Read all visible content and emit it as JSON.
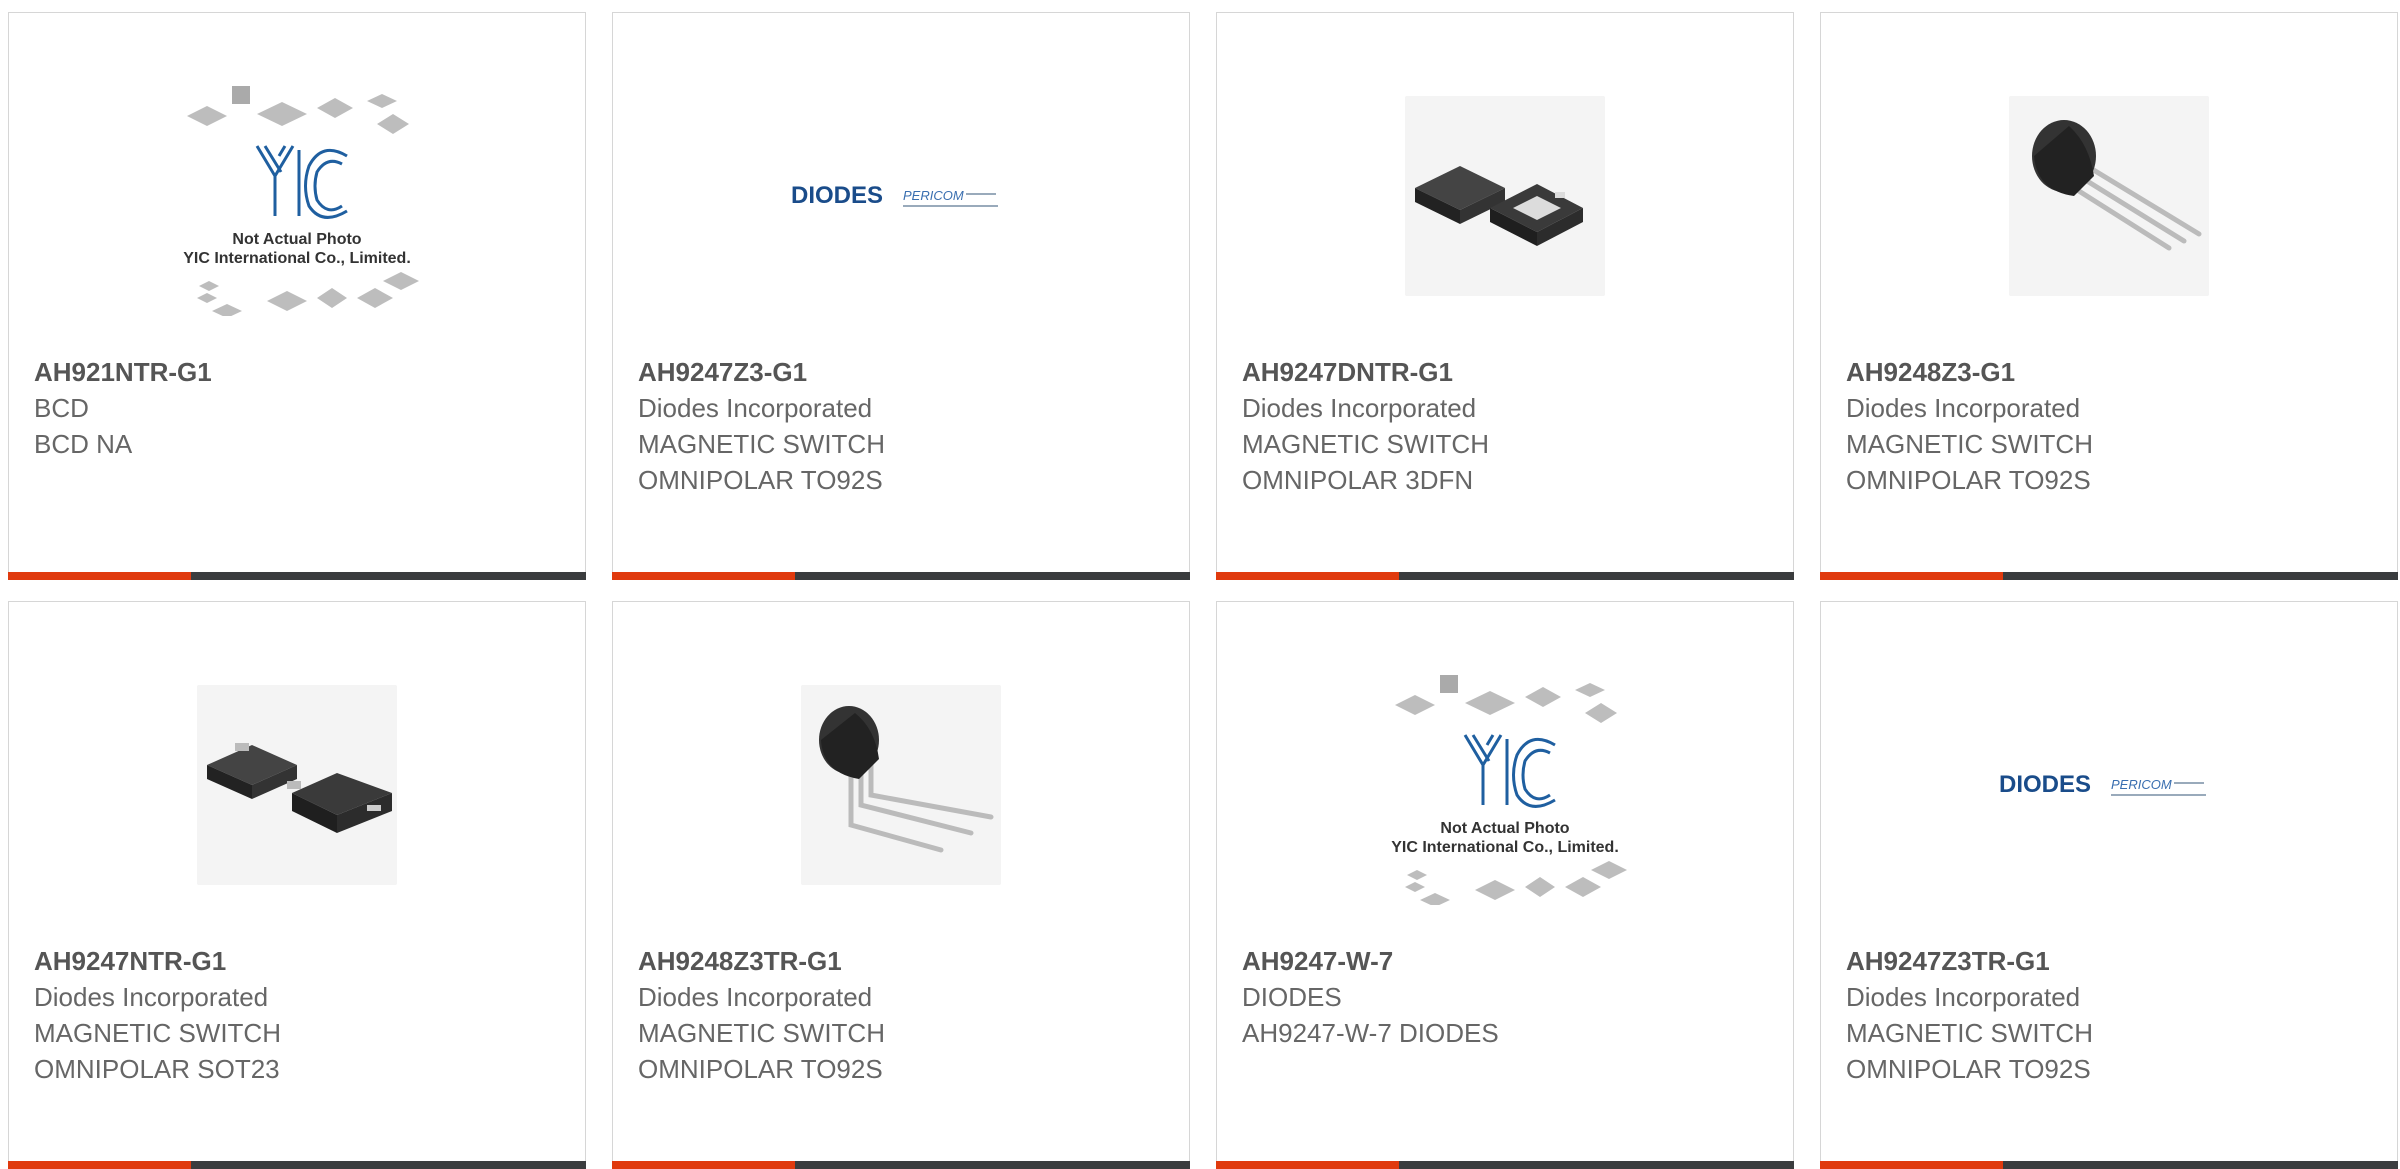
{
  "colors": {
    "accent": "#e03a0e",
    "bar": "#3a3c3e",
    "text": "#666666",
    "border": "#d6d6d6"
  },
  "products": [
    {
      "part": "AH921NTR-G1",
      "mfr": "BCD",
      "desc1": "BCD NA",
      "desc2": "",
      "image": "placeholder-yic",
      "placeholder": {
        "line1": "Not Actual Photo",
        "line2": "YIC International Co., Limited.",
        "logo": "YIC"
      }
    },
    {
      "part": "AH9247Z3-G1",
      "mfr": "Diodes Incorporated",
      "desc1": "MAGNETIC SWITCH",
      "desc2": "OMNIPOLAR TO92S",
      "image": "diodes-logo",
      "logo": {
        "brand": "DIODES",
        "sub": "PERICOM"
      }
    },
    {
      "part": "AH9247DNTR-G1",
      "mfr": "Diodes Incorporated",
      "desc1": "MAGNETIC SWITCH",
      "desc2": "OMNIPOLAR 3DFN",
      "image": "dfn-package"
    },
    {
      "part": "AH9248Z3-G1",
      "mfr": "Diodes Incorporated",
      "desc1": "MAGNETIC SWITCH",
      "desc2": "OMNIPOLAR TO92S",
      "image": "to92-package"
    },
    {
      "part": "AH9247NTR-G1",
      "mfr": "Diodes Incorporated",
      "desc1": "MAGNETIC SWITCH",
      "desc2": "OMNIPOLAR SOT23",
      "image": "sot23-package"
    },
    {
      "part": "AH9248Z3TR-G1",
      "mfr": "Diodes Incorporated",
      "desc1": "MAGNETIC SWITCH",
      "desc2": "OMNIPOLAR TO92S",
      "image": "to92-bent-package"
    },
    {
      "part": "AH9247-W-7",
      "mfr": "DIODES",
      "desc1": "AH9247-W-7 DIODES",
      "desc2": "",
      "image": "placeholder-yic",
      "placeholder": {
        "line1": "Not Actual Photo",
        "line2": "YIC International Co., Limited.",
        "logo": "YIC"
      }
    },
    {
      "part": "AH9247Z3TR-G1",
      "mfr": "Diodes Incorporated",
      "desc1": "MAGNETIC SWITCH",
      "desc2": "OMNIPOLAR TO92S",
      "image": "diodes-logo",
      "logo": {
        "brand": "DIODES",
        "sub": "PERICOM"
      }
    }
  ]
}
